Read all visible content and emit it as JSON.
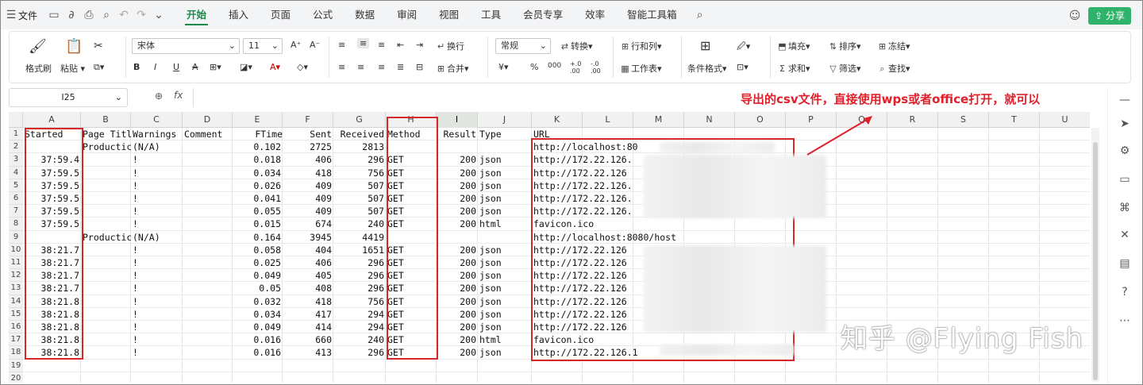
{
  "menubar": {
    "file": "文件",
    "tabs": [
      "开始",
      "插入",
      "页面",
      "公式",
      "数据",
      "审阅",
      "视图",
      "工具",
      "会员专享",
      "效率",
      "智能工具箱"
    ],
    "active_tab": "开始",
    "share": "分享"
  },
  "ribbon": {
    "format_painter": "格式刷",
    "paste": "粘贴",
    "font_name": "宋体",
    "font_size": "11",
    "wrap": "换行",
    "merge": "合并",
    "number_format": "常规",
    "convert": "转换",
    "rows_cols": "行和列",
    "worksheet": "工作表",
    "cond_format": "条件格式",
    "fill": "填充",
    "sort": "排序",
    "freeze": "冻结",
    "sum": "求和",
    "filter": "筛选",
    "find": "查找",
    "percent": "%",
    "thousands": "000",
    "inc_dec1": "+.0 .00",
    "inc_dec2": "-.0 .00",
    "currency": "¥"
  },
  "formula_bar": {
    "name_box": "I25",
    "fx": "fx",
    "value": ""
  },
  "annotation": "导出的csv文件，直接使用wps或者office打开，就可以",
  "watermark": "知乎 @Flying Fish",
  "columns": [
    "A",
    "B",
    "C",
    "D",
    "E",
    "F",
    "G",
    "H",
    "I",
    "J",
    "K",
    "L",
    "M",
    "N",
    "O",
    "P",
    "Q",
    "R",
    "S",
    "T",
    "U"
  ],
  "selected_column": "I",
  "rows": [
    {
      "n": "1",
      "A": "Started",
      "B": "Page Titl",
      "C": "Warnings",
      "D": "Comment",
      "E": "FTime",
      "F": "Sent",
      "G": "Received",
      "H": "Method",
      "I": "Result",
      "J": "Type",
      "K": "URL"
    },
    {
      "n": "2",
      "A": "",
      "B": "Productic",
      "C": "(N/A)",
      "D": "",
      "E": "0.102",
      "F": "2725",
      "G": "2813",
      "H": "",
      "I": "",
      "J": "",
      "K": "http://localhost:80"
    },
    {
      "n": "3",
      "A": "37:59.4",
      "B": "",
      "C": "!",
      "D": "",
      "E": "0.018",
      "F": "406",
      "G": "296",
      "H": "GET",
      "I": "200",
      "J": "json",
      "K": "http://172.22.126."
    },
    {
      "n": "4",
      "A": "37:59.5",
      "B": "",
      "C": "!",
      "D": "",
      "E": "0.034",
      "F": "418",
      "G": "756",
      "H": "GET",
      "I": "200",
      "J": "json",
      "K": "http://172.22.126"
    },
    {
      "n": "5",
      "A": "37:59.5",
      "B": "",
      "C": "!",
      "D": "",
      "E": "0.026",
      "F": "409",
      "G": "507",
      "H": "GET",
      "I": "200",
      "J": "json",
      "K": "http://172.22.126."
    },
    {
      "n": "6",
      "A": "37:59.5",
      "B": "",
      "C": "!",
      "D": "",
      "E": "0.041",
      "F": "409",
      "G": "507",
      "H": "GET",
      "I": "200",
      "J": "json",
      "K": "http://172.22.126."
    },
    {
      "n": "7",
      "A": "37:59.5",
      "B": "",
      "C": "!",
      "D": "",
      "E": "0.055",
      "F": "409",
      "G": "507",
      "H": "GET",
      "I": "200",
      "J": "json",
      "K": "http://172.22.126."
    },
    {
      "n": "8",
      "A": "37:59.5",
      "B": "",
      "C": "!",
      "D": "",
      "E": "0.015",
      "F": "674",
      "G": "240",
      "H": "GET",
      "I": "200",
      "J": "html",
      "K": "favicon.ico"
    },
    {
      "n": "9",
      "A": "",
      "B": "Productic",
      "C": "(N/A)",
      "D": "",
      "E": "0.164",
      "F": "3945",
      "G": "4419",
      "H": "",
      "I": "",
      "J": "",
      "K": "http://localhost:8080/host"
    },
    {
      "n": "10",
      "A": "38:21.7",
      "B": "",
      "C": "!",
      "D": "",
      "E": "0.058",
      "F": "404",
      "G": "1651",
      "H": "GET",
      "I": "200",
      "J": "json",
      "K": "http://172.22.126"
    },
    {
      "n": "11",
      "A": "38:21.7",
      "B": "",
      "C": "!",
      "D": "",
      "E": "0.025",
      "F": "406",
      "G": "296",
      "H": "GET",
      "I": "200",
      "J": "json",
      "K": "http://172.22.126"
    },
    {
      "n": "12",
      "A": "38:21.7",
      "B": "",
      "C": "!",
      "D": "",
      "E": "0.049",
      "F": "405",
      "G": "296",
      "H": "GET",
      "I": "200",
      "J": "json",
      "K": "http://172.22.126"
    },
    {
      "n": "13",
      "A": "38:21.7",
      "B": "",
      "C": "!",
      "D": "",
      "E": "0.05",
      "F": "408",
      "G": "296",
      "H": "GET",
      "I": "200",
      "J": "json",
      "K": "http://172.22.126"
    },
    {
      "n": "14",
      "A": "38:21.8",
      "B": "",
      "C": "!",
      "D": "",
      "E": "0.032",
      "F": "418",
      "G": "756",
      "H": "GET",
      "I": "200",
      "J": "json",
      "K": "http://172.22.126"
    },
    {
      "n": "15",
      "A": "38:21.8",
      "B": "",
      "C": "!",
      "D": "",
      "E": "0.034",
      "F": "417",
      "G": "294",
      "H": "GET",
      "I": "200",
      "J": "json",
      "K": "http://172.22.126"
    },
    {
      "n": "16",
      "A": "38:21.8",
      "B": "",
      "C": "!",
      "D": "",
      "E": "0.049",
      "F": "414",
      "G": "294",
      "H": "GET",
      "I": "200",
      "J": "json",
      "K": "http://172.22.126"
    },
    {
      "n": "17",
      "A": "38:21.8",
      "B": "",
      "C": "!",
      "D": "",
      "E": "0.016",
      "F": "660",
      "G": "240",
      "H": "GET",
      "I": "200",
      "J": "html",
      "K": "favicon.ico"
    },
    {
      "n": "18",
      "A": "38:21.8",
      "B": "",
      "C": "!",
      "D": "",
      "E": "0.016",
      "F": "413",
      "G": "296",
      "H": "GET",
      "I": "200",
      "J": "json",
      "K": "http://172.22.126.1"
    },
    {
      "n": "19",
      "A": "",
      "B": "",
      "C": "",
      "D": "",
      "E": "",
      "F": "",
      "G": "",
      "H": "",
      "I": "",
      "J": "",
      "K": ""
    },
    {
      "n": "20",
      "A": "",
      "B": "",
      "C": "",
      "D": "",
      "E": "",
      "F": "",
      "G": "",
      "H": "",
      "I": "",
      "J": "",
      "K": ""
    }
  ],
  "colors": {
    "accent": "#1a8a4a",
    "annotation_red": "#e0202a",
    "share_bg": "#2fb36b"
  }
}
